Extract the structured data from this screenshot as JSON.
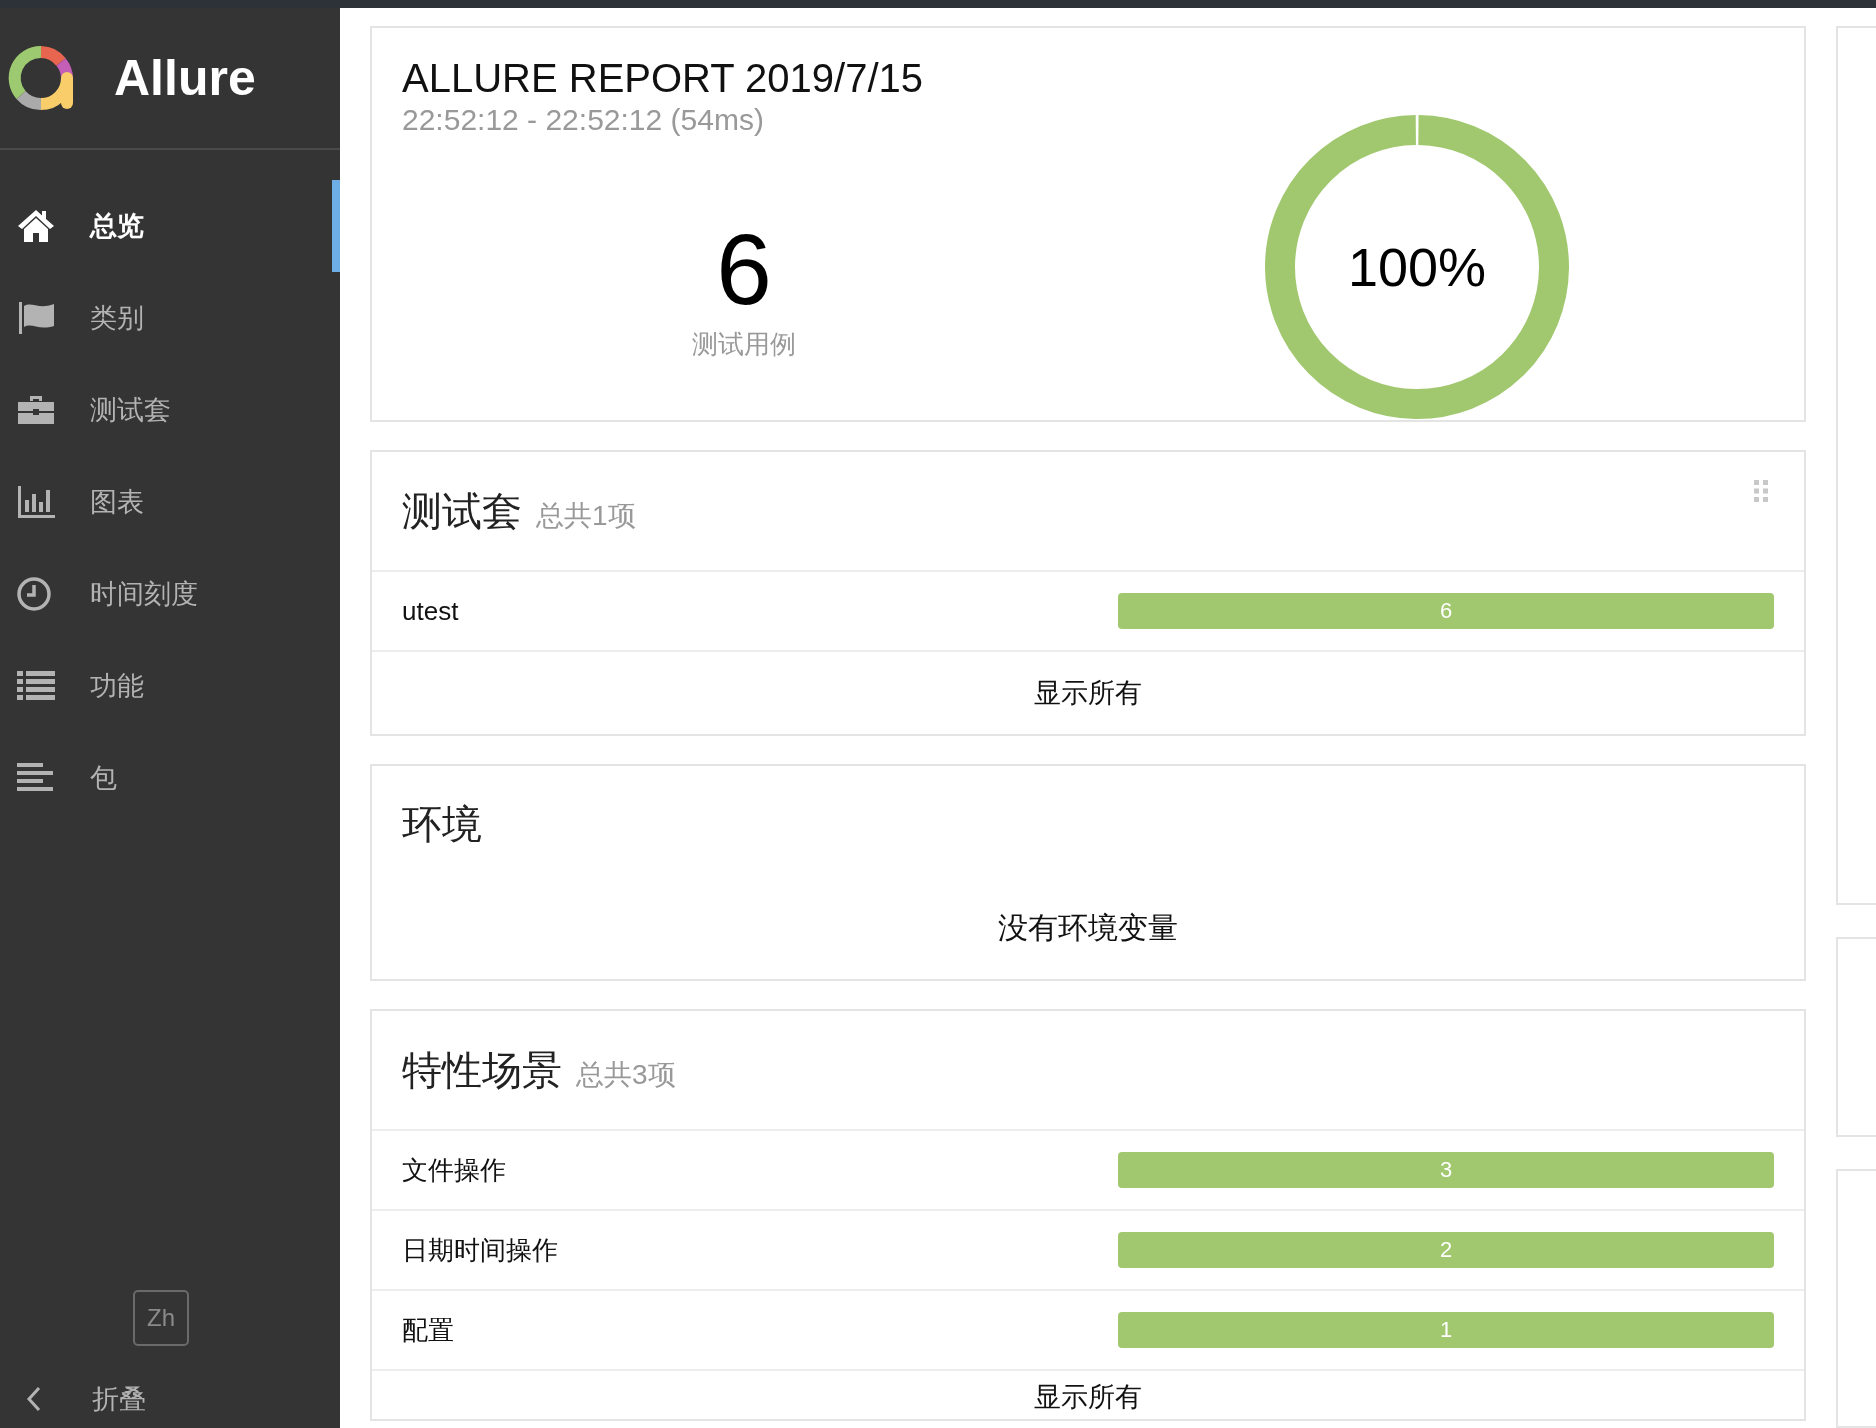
{
  "sidebar": {
    "brand": "Allure",
    "items": [
      {
        "label": "总览",
        "kind": "overview",
        "selected": true
      },
      {
        "label": "类别",
        "kind": "categories",
        "selected": false
      },
      {
        "label": "测试套",
        "kind": "suites",
        "selected": false
      },
      {
        "label": "图表",
        "kind": "graphs",
        "selected": false
      },
      {
        "label": "时间刻度",
        "kind": "timeline",
        "selected": false
      },
      {
        "label": "功能",
        "kind": "behaviors",
        "selected": false
      },
      {
        "label": "包",
        "kind": "packages",
        "selected": false
      }
    ],
    "language": "Zh",
    "collapse": "折叠"
  },
  "summary": {
    "title": "ALLURE REPORT 2019/7/15",
    "time_range": "22:52:12 - 22:52:12 (54ms)",
    "test_count": "6",
    "test_count_label": "测试用例",
    "percent": "100%",
    "level": 1
  },
  "suites": {
    "title": "测试套",
    "total": "总共1项",
    "rows": [
      {
        "name": "utest",
        "count": "6",
        "level": 1
      }
    ],
    "show_all": "显示所有"
  },
  "environment": {
    "title": "环境",
    "message": "没有环境变量"
  },
  "features": {
    "title": "特性场景",
    "total": "总共3项",
    "rows": [
      {
        "name": "文件操作",
        "count": "3",
        "level": 1
      },
      {
        "name": "日期时间操作",
        "count": "2",
        "level": 1
      },
      {
        "name": "配置",
        "count": "1",
        "level": 1
      }
    ],
    "show_all": "显示所有"
  }
}
